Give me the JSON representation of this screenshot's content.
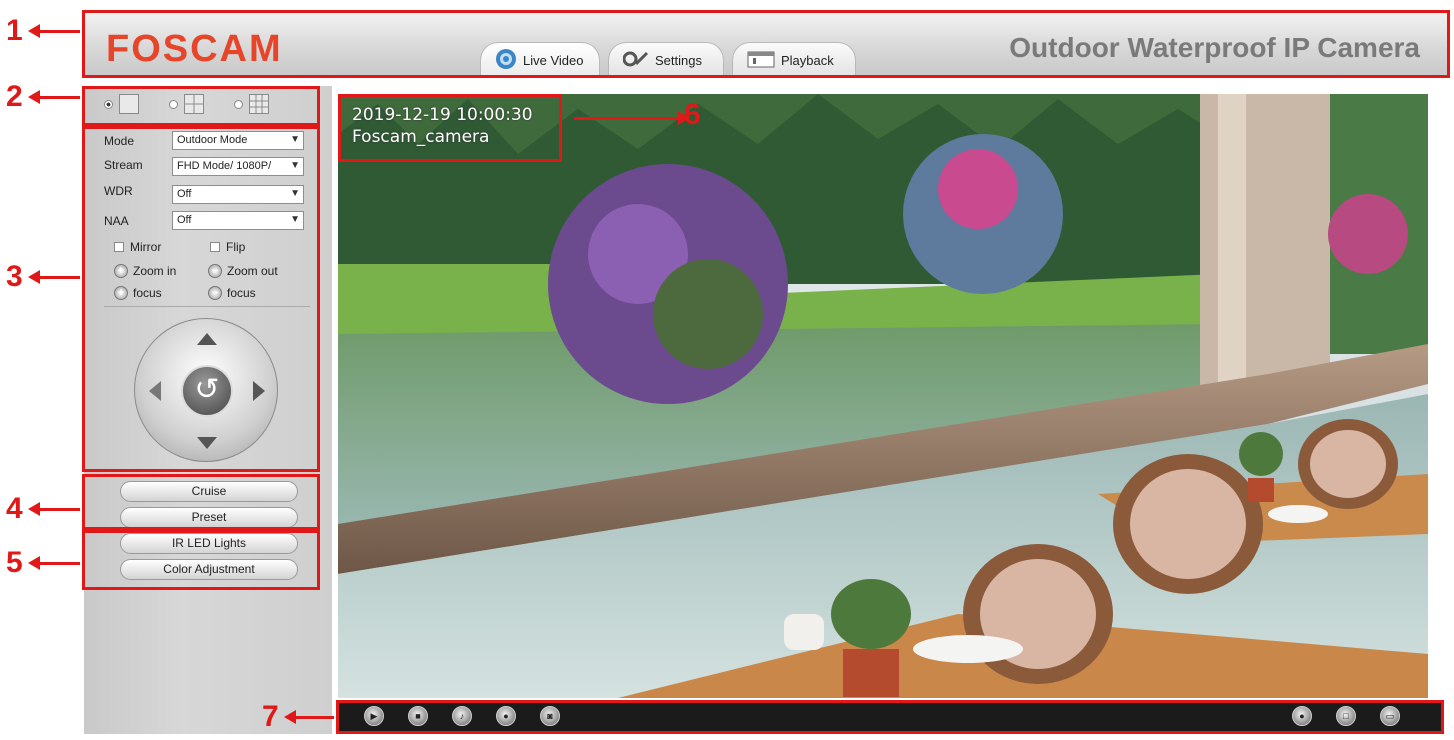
{
  "header": {
    "logo": "FOSCAM",
    "product_title": "Outdoor Waterproof IP Camera",
    "tabs": [
      {
        "label": "Live Video",
        "icon": "camera-lens-icon",
        "active": true
      },
      {
        "label": "Settings",
        "icon": "wrench-icon",
        "active": false
      },
      {
        "label": "Playback",
        "icon": "film-strip-icon",
        "active": false
      }
    ]
  },
  "layout_options": [
    "single-view-icon",
    "four-view-icon",
    "nine-view-icon"
  ],
  "controls": {
    "mode": {
      "label": "Mode",
      "value": "Outdoor Mode"
    },
    "stream": {
      "label": "Stream",
      "value": "FHD Mode/ 1080P/"
    },
    "wdr": {
      "label": "WDR",
      "value": "Off"
    },
    "naa": {
      "label": "NAA",
      "value": "Off"
    },
    "mirror": "Mirror",
    "flip": "Flip",
    "zoom_in": "Zoom in",
    "zoom_out": "Zoom out",
    "focus_plus": "focus",
    "focus_minus": "focus"
  },
  "buttons": {
    "cruise": "Cruise",
    "preset": "Preset",
    "ir_led": "IR LED Lights",
    "color_adjust": "Color Adjustment"
  },
  "osd": {
    "datetime": "2019-12-19  10:00:30",
    "camera_name": "Foscam_camera"
  },
  "callouts": [
    "1",
    "2",
    "3",
    "4",
    "5",
    "6",
    "7"
  ],
  "colors": {
    "annotation": "#e01818",
    "logo": "#e6452a"
  }
}
